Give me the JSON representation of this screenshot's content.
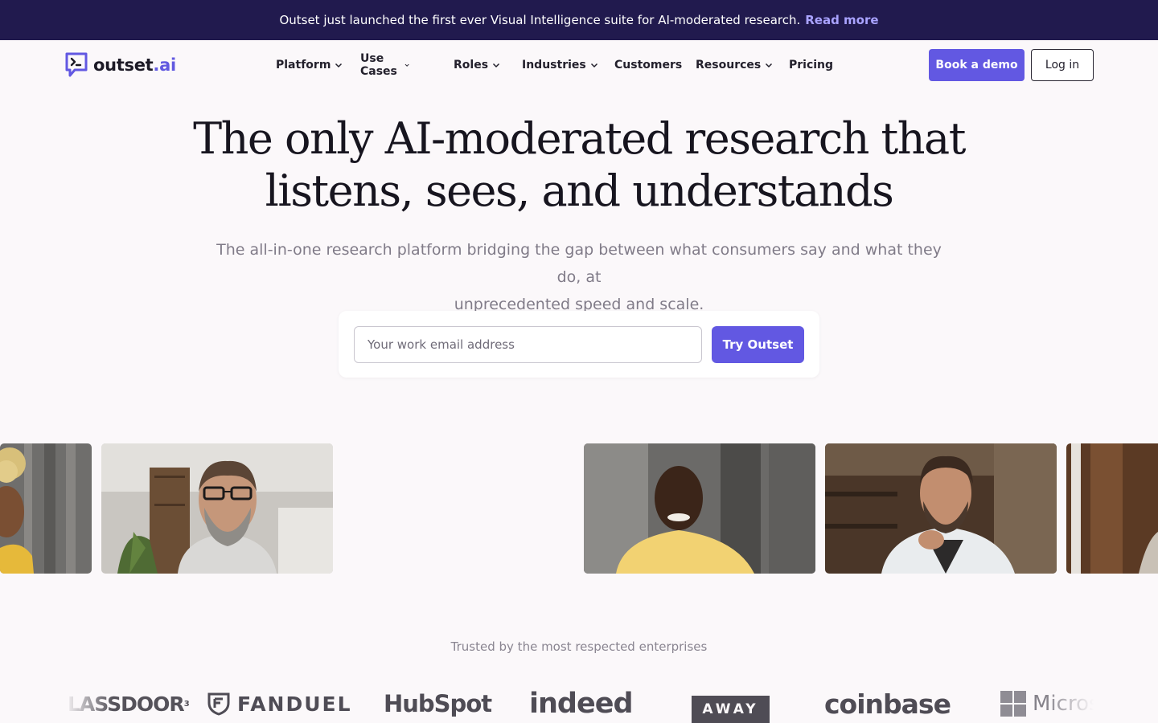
{
  "announcement": {
    "text": "Outset just launched the first ever Visual Intelligence suite for AI-moderated research.",
    "link": "Read more"
  },
  "brand": {
    "name": "outset",
    "suffix": ".ai",
    "accent": "#6258e2",
    "dark": "#211a4e"
  },
  "nav": {
    "items": [
      {
        "label": "Platform",
        "dropdown": true
      },
      {
        "label": "Use Cases",
        "dropdown": true
      },
      {
        "label": "Roles",
        "dropdown": true
      },
      {
        "label": "Industries",
        "dropdown": true
      },
      {
        "label": "Customers",
        "dropdown": false
      },
      {
        "label": "Resources",
        "dropdown": true
      },
      {
        "label": "Pricing",
        "dropdown": false
      }
    ],
    "demo_button": "Book a demo",
    "login_button": "Log in"
  },
  "hero": {
    "title_line1": "The only AI-moderated research that",
    "title_line2": "listens, sees, and understands",
    "subtitle_line1": "The all-in-one research platform bridging the gap between what consumers say and what they do, at",
    "subtitle_line2": "unprecedented speed and scale.",
    "email_placeholder": "Your work email address",
    "cta": "Try Outset"
  },
  "video_tiles": [
    {
      "subject": "woman-yellow-top-icon"
    },
    {
      "subject": "man-glasses-icon"
    },
    {
      "subject": "man-yellow-shirt-icon"
    },
    {
      "subject": "man-lab-coat-icon"
    },
    {
      "subject": "partial-tile-icon"
    }
  ],
  "trusted": {
    "heading": "Trusted by the most respected enterprises",
    "logos": [
      "LASSDOOR",
      "FANDUEL",
      "HubSpot",
      "indeed",
      "AWAY",
      "coinbase",
      "Micros"
    ]
  }
}
